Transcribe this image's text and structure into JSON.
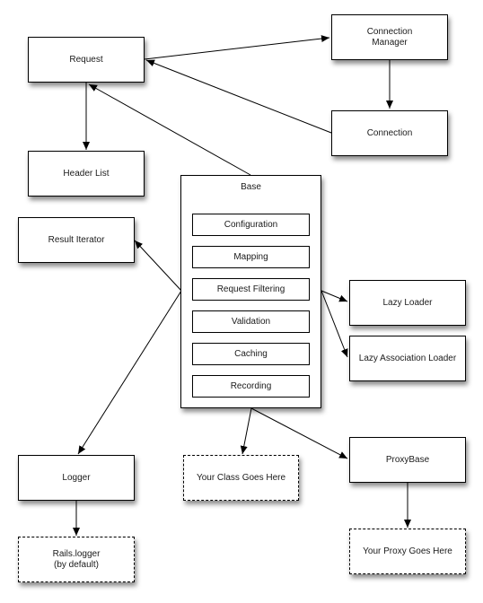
{
  "diagram": {
    "nodes": {
      "request": "Request",
      "connection_manager": "Connection\nManager",
      "connection": "Connection",
      "header_list": "Header List",
      "result_iterator": "Result Iterator",
      "base": "Base",
      "lazy_loader": "Lazy Loader",
      "lazy_association_loader": "Lazy Association Loader",
      "logger": "Logger",
      "your_class": "Your Class Goes Here",
      "proxy_base": "ProxyBase",
      "rails_logger": "Rails.logger\n(by default)",
      "your_proxy": "Your Proxy Goes Here"
    },
    "base_modules": [
      "Configuration",
      "Mapping",
      "Request Filtering",
      "Validation",
      "Caching",
      "Recording"
    ],
    "edges": [
      {
        "from": "request",
        "to": "connection_manager"
      },
      {
        "from": "connection_manager",
        "to": "connection"
      },
      {
        "from": "connection",
        "to": "request"
      },
      {
        "from": "request",
        "to": "header_list"
      },
      {
        "from": "base",
        "to": "request"
      },
      {
        "from": "base",
        "to": "result_iterator"
      },
      {
        "from": "base",
        "to": "logger"
      },
      {
        "from": "base",
        "to": "lazy_loader"
      },
      {
        "from": "base",
        "to": "lazy_association_loader"
      },
      {
        "from": "base",
        "to": "your_class"
      },
      {
        "from": "base",
        "to": "proxy_base"
      },
      {
        "from": "logger",
        "to": "rails_logger"
      },
      {
        "from": "proxy_base",
        "to": "your_proxy"
      }
    ]
  }
}
